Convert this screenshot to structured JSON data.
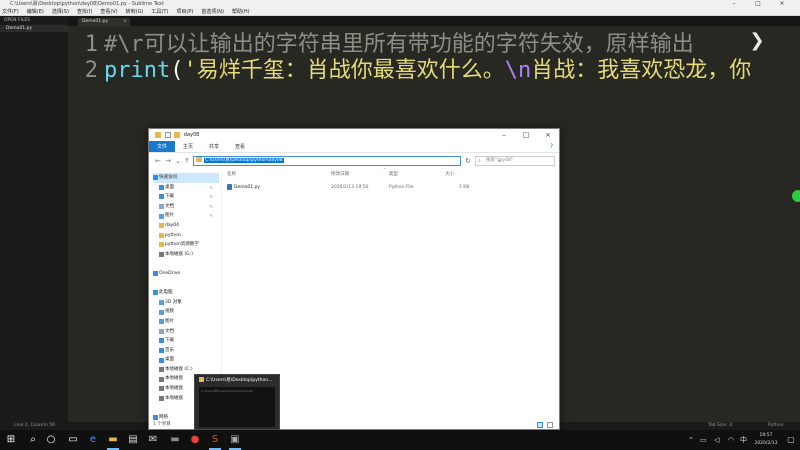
{
  "sublime": {
    "title": "C:\\Users\\易\\Desktop\\python\\day08\\Demo01.py - Sublime Text",
    "menu": [
      "文件(F)",
      "编辑(E)",
      "选择(S)",
      "查找(I)",
      "查看(V)",
      "转到(G)",
      "工具(T)",
      "项目(P)",
      "首选项(N)",
      "帮助(H)"
    ],
    "sidebar_header": "OPEN FILES",
    "sidebar_file": "Demo01.py",
    "tab_label": "Demo01.py",
    "lines": [
      {
        "number": "1",
        "comment": "#\\r可以让输出的字符串里所有带功能的字符失效，原样输出"
      },
      {
        "number": "2",
        "func": "print",
        "open": "(",
        "str_a": "'易烊千玺：肖战你最喜欢什么。",
        "escape": "\\n",
        "str_b": "肖战：我喜欢恐龙，你"
      }
    ],
    "status_left": "Line 2, Column 56",
    "status_tab": "Tab Size: 4",
    "status_syntax": "Python"
  },
  "explorer": {
    "title": "day08",
    "ribbon_tabs": [
      "文件",
      "主页",
      "共享",
      "查看"
    ],
    "address": "C:\\Users\\易\\Desktop\\python\\day08",
    "search_placeholder": "搜索\"day08\"",
    "columns": {
      "name": "名称",
      "date": "修改日期",
      "type": "类型",
      "size": "大小"
    },
    "files": [
      {
        "name": "Demo01.py",
        "date": "2020/2/13 19:50",
        "type": "Python File",
        "size": "1 KB"
      }
    ],
    "nav": [
      {
        "label": "快速访问",
        "section": true,
        "icon": "star-icon",
        "pinned": false
      },
      {
        "label": "桌面",
        "section": false,
        "icon": "desktop-icon",
        "pinned": true
      },
      {
        "label": "下载",
        "section": false,
        "icon": "download-icon",
        "pinned": true
      },
      {
        "label": "文档",
        "section": false,
        "icon": "document-icon",
        "pinned": true
      },
      {
        "label": "图片",
        "section": false,
        "icon": "picture-icon",
        "pinned": true
      },
      {
        "label": "day04",
        "section": false,
        "icon": "folder-icon",
        "pinned": false
      },
      {
        "label": "python",
        "section": false,
        "icon": "folder-icon",
        "pinned": false
      },
      {
        "label": "python资源教学",
        "section": false,
        "icon": "folder-icon",
        "pinned": false
      },
      {
        "label": "本地磁盘 (G:)",
        "section": false,
        "icon": "drive-icon",
        "pinned": false
      },
      {
        "label": "",
        "section": false,
        "icon": "",
        "pinned": false
      },
      {
        "label": "OneDrive",
        "section": true,
        "icon": "cloud-icon",
        "pinned": false
      },
      {
        "label": "",
        "section": false,
        "icon": "",
        "pinned": false
      },
      {
        "label": "此电脑",
        "section": true,
        "icon": "computer-icon",
        "pinned": false
      },
      {
        "label": "3D 对象",
        "section": false,
        "icon": "cube-icon",
        "pinned": false
      },
      {
        "label": "视频",
        "section": false,
        "icon": "video-icon",
        "pinned": false
      },
      {
        "label": "图片",
        "section": false,
        "icon": "picture-icon",
        "pinned": false
      },
      {
        "label": "文档",
        "section": false,
        "icon": "document-icon",
        "pinned": false
      },
      {
        "label": "下载",
        "section": false,
        "icon": "download-icon",
        "pinned": false
      },
      {
        "label": "音乐",
        "section": false,
        "icon": "music-icon",
        "pinned": false
      },
      {
        "label": "桌面",
        "section": false,
        "icon": "desktop-icon",
        "pinned": false
      },
      {
        "label": "本地磁盘 (C:)",
        "section": false,
        "icon": "drive-icon",
        "pinned": false
      },
      {
        "label": "本地磁盘",
        "section": false,
        "icon": "drive-icon",
        "pinned": false
      },
      {
        "label": "本地磁盘",
        "section": false,
        "icon": "drive-icon",
        "pinned": false
      },
      {
        "label": "本地磁盘",
        "section": false,
        "icon": "drive-icon",
        "pinned": false
      },
      {
        "label": "",
        "section": false,
        "icon": "",
        "pinned": false
      },
      {
        "label": "网络",
        "section": true,
        "icon": "network-icon",
        "pinned": false
      }
    ],
    "item_count": "1 个项目"
  },
  "preview": {
    "title": "C:\\Users\\易\\Desktop\\python...",
    "thumb_text": "C:\\Users\\易\\Desktop\\python\\day08"
  },
  "taskbar": {
    "icons": [
      {
        "name": "start-icon",
        "glyph": "⊞",
        "active": false
      },
      {
        "name": "search-icon",
        "glyph": "⌕",
        "active": false
      },
      {
        "name": "task-view-icon",
        "glyph": "○",
        "active": false
      },
      {
        "name": "task-view-alt-icon",
        "glyph": "▭",
        "active": false
      },
      {
        "name": "edge-icon",
        "glyph": "e",
        "active": false
      },
      {
        "name": "file-explorer-icon",
        "glyph": "▬",
        "active": true
      },
      {
        "name": "store-icon",
        "glyph": "▤",
        "active": false
      },
      {
        "name": "mail-icon",
        "glyph": "✉",
        "active": false
      },
      {
        "name": "terminal-icon",
        "glyph": "▬",
        "active": false
      },
      {
        "name": "chrome-icon",
        "glyph": "●",
        "active": false
      },
      {
        "name": "sublime-text-icon",
        "glyph": "S",
        "active": true
      },
      {
        "name": "recorder-icon",
        "glyph": "▣",
        "active": true
      }
    ],
    "time": "19:57",
    "date": "2020/2/13",
    "ime": "中"
  },
  "colors": {
    "editor_bg": "#272822",
    "comment": "#8e8e87",
    "keyword": "#66d9ef",
    "string": "#e6db74",
    "escape": "#ae81ff",
    "explorer_accent": "#1979ca",
    "address_selection": "#0078d7"
  }
}
